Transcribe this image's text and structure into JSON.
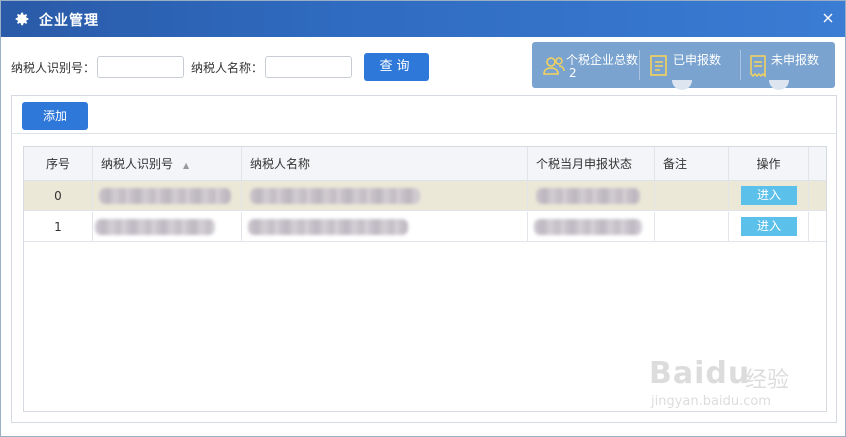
{
  "window": {
    "title": "企业管理",
    "close_icon": "close-icon",
    "title_icon": "gear-icon"
  },
  "search": {
    "taxpayer_id_label": "纳税人识别号：",
    "taxpayer_id_value": "",
    "taxpayer_name_label": "纳税人名称：",
    "taxpayer_name_value": "",
    "query_label": "查询"
  },
  "stats": {
    "total": {
      "label": "个税企业总数",
      "value": "2",
      "icon": "users-icon"
    },
    "declared": {
      "label": "已申报数",
      "value": "",
      "icon": "document-icon"
    },
    "undeclared": {
      "label": "未申报数",
      "value": "",
      "icon": "receipt-icon"
    }
  },
  "toolbar": {
    "add_label": "添加"
  },
  "table": {
    "columns": [
      "序号",
      "纳税人识别号",
      "纳税人名称",
      "个税当月申报状态",
      "备注",
      "操作"
    ],
    "rows": [
      {
        "index": "0",
        "taxpayer_id": "",
        "taxpayer_name": "",
        "status": "",
        "note": "",
        "action": "进入"
      },
      {
        "index": "1",
        "taxpayer_id": "",
        "taxpayer_name": "",
        "status": "",
        "note": "",
        "action": "进入"
      }
    ]
  },
  "watermark": {
    "brand": "Baidu",
    "brand_cn": "经验",
    "url": "jingyan.baidu.com"
  },
  "colors": {
    "titlebar": "#2f6bc0",
    "primary_button": "#2e78d9",
    "stats_panel": "#7aa3cf",
    "selected_row": "#ece8d8",
    "enter_button": "#5bc0ea"
  }
}
